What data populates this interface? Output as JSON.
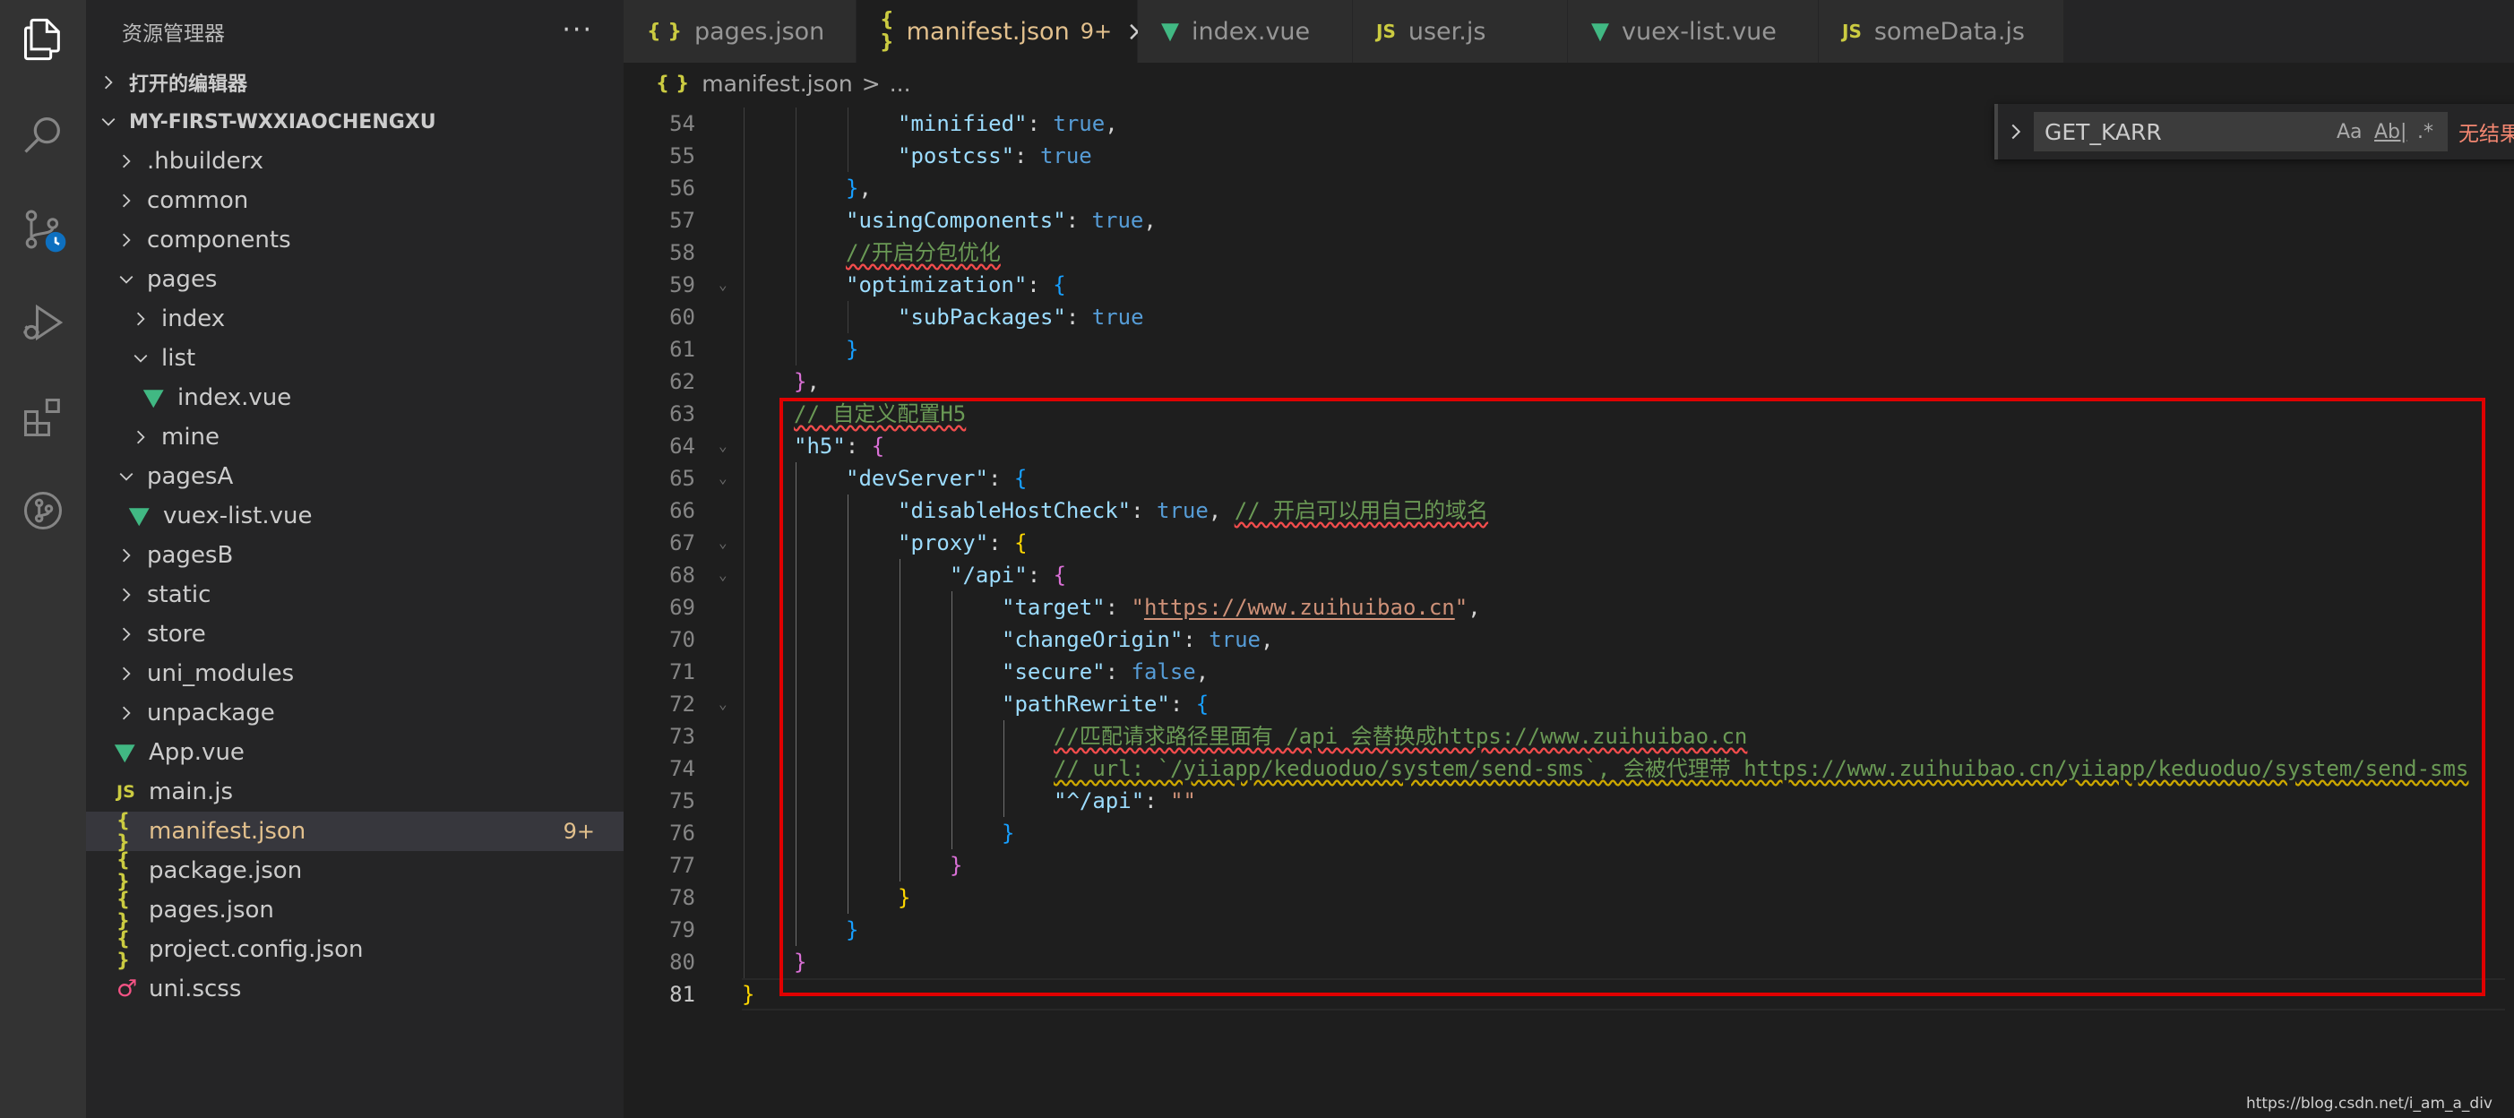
{
  "sidebar": {
    "title": "资源管理器",
    "more": "···",
    "open_editors": "打开的编辑器",
    "project": "MY-FIRST-WXXIAOCHENGXU",
    "items": [
      {
        "label": ".hbuilderx",
        "kind": "folder",
        "depth": 0,
        "expanded": false
      },
      {
        "label": "common",
        "kind": "folder",
        "depth": 0,
        "expanded": false
      },
      {
        "label": "components",
        "kind": "folder",
        "depth": 0,
        "expanded": false
      },
      {
        "label": "pages",
        "kind": "folder",
        "depth": 0,
        "expanded": true
      },
      {
        "label": "index",
        "kind": "folder",
        "depth": 1,
        "expanded": false
      },
      {
        "label": "list",
        "kind": "folder",
        "depth": 1,
        "expanded": true
      },
      {
        "label": "index.vue",
        "kind": "vue",
        "depth": 2
      },
      {
        "label": "mine",
        "kind": "folder",
        "depth": 1,
        "expanded": false
      },
      {
        "label": "pagesA",
        "kind": "folder",
        "depth": 0,
        "expanded": true
      },
      {
        "label": "vuex-list.vue",
        "kind": "vue",
        "depth": 1
      },
      {
        "label": "pagesB",
        "kind": "folder",
        "depth": 0,
        "expanded": false
      },
      {
        "label": "static",
        "kind": "folder",
        "depth": 0,
        "expanded": false
      },
      {
        "label": "store",
        "kind": "folder",
        "depth": 0,
        "expanded": false
      },
      {
        "label": "uni_modules",
        "kind": "folder",
        "depth": 0,
        "expanded": false
      },
      {
        "label": "unpackage",
        "kind": "folder",
        "depth": 0,
        "expanded": false
      },
      {
        "label": "App.vue",
        "kind": "vue",
        "depth": 0
      },
      {
        "label": "main.js",
        "kind": "js",
        "depth": 0
      },
      {
        "label": "manifest.json",
        "kind": "json",
        "depth": 0,
        "active": true,
        "badge": "9+"
      },
      {
        "label": "package.json",
        "kind": "json",
        "depth": 0
      },
      {
        "label": "pages.json",
        "kind": "json",
        "depth": 0
      },
      {
        "label": "project.config.json",
        "kind": "json",
        "depth": 0
      },
      {
        "label": "uni.scss",
        "kind": "scss",
        "depth": 0
      }
    ]
  },
  "tabs": [
    {
      "label": "pages.json",
      "kind": "json"
    },
    {
      "label": "manifest.json",
      "kind": "json",
      "active": true,
      "badge": "9+",
      "close": "×"
    },
    {
      "label": "index.vue",
      "kind": "vue"
    },
    {
      "label": "user.js",
      "kind": "js"
    },
    {
      "label": "vuex-list.vue",
      "kind": "vue"
    },
    {
      "label": "someData.js",
      "kind": "js"
    }
  ],
  "breadcrumb": {
    "file": "manifest.json",
    "sep": ">",
    "rest": "..."
  },
  "find": {
    "query": "GET_KARR",
    "opt_case": "Aa",
    "opt_word": "Ab|",
    "opt_regex": ".*",
    "result": "无结果"
  },
  "editor": {
    "lines": [
      {
        "n": "54",
        "indent": 3,
        "segments": [
          [
            "k",
            "\"minified\""
          ],
          [
            "p",
            ": "
          ],
          [
            "b",
            "true"
          ],
          [
            "p",
            ","
          ]
        ]
      },
      {
        "n": "55",
        "indent": 3,
        "segments": [
          [
            "k",
            "\"postcss\""
          ],
          [
            "p",
            ": "
          ],
          [
            "b",
            "true"
          ]
        ]
      },
      {
        "n": "56",
        "indent": 2,
        "segments": [
          [
            "br3",
            "}"
          ],
          [
            "p",
            ","
          ]
        ]
      },
      {
        "n": "57",
        "indent": 2,
        "segments": [
          [
            "k",
            "\"usingComponents\""
          ],
          [
            "p",
            ": "
          ],
          [
            "b",
            "true"
          ],
          [
            "p",
            ","
          ]
        ]
      },
      {
        "n": "58",
        "indent": 2,
        "segments": [
          [
            "c squig",
            "//开启分包优化"
          ]
        ]
      },
      {
        "n": "59",
        "indent": 2,
        "fold": true,
        "segments": [
          [
            "k",
            "\"optimization\""
          ],
          [
            "p",
            ": "
          ],
          [
            "br3",
            "{"
          ]
        ]
      },
      {
        "n": "60",
        "indent": 3,
        "segments": [
          [
            "k",
            "\"subPackages\""
          ],
          [
            "p",
            ": "
          ],
          [
            "b",
            "true"
          ]
        ]
      },
      {
        "n": "61",
        "indent": 2,
        "segments": [
          [
            "br3",
            "}"
          ]
        ]
      },
      {
        "n": "62",
        "indent": 1,
        "segments": [
          [
            "br2",
            "}"
          ],
          [
            "p",
            ","
          ]
        ]
      },
      {
        "n": "63",
        "indent": 1,
        "segments": [
          [
            "c squig",
            "// 自定义配置H5"
          ]
        ]
      },
      {
        "n": "64",
        "indent": 1,
        "fold": true,
        "segments": [
          [
            "k",
            "\"h5\""
          ],
          [
            "p",
            ": "
          ],
          [
            "br2",
            "{"
          ]
        ]
      },
      {
        "n": "65",
        "indent": 2,
        "fold": true,
        "segments": [
          [
            "k",
            "\"devServer\""
          ],
          [
            "p",
            ": "
          ],
          [
            "br3",
            "{"
          ]
        ]
      },
      {
        "n": "66",
        "indent": 3,
        "segments": [
          [
            "k",
            "\"disableHostCheck\""
          ],
          [
            "p",
            ": "
          ],
          [
            "b",
            "true"
          ],
          [
            "p",
            ", "
          ],
          [
            "c squig",
            "// 开启可以用自己的域名"
          ]
        ]
      },
      {
        "n": "67",
        "indent": 3,
        "fold": true,
        "segments": [
          [
            "k",
            "\"proxy\""
          ],
          [
            "p",
            ": "
          ],
          [
            "br1",
            "{"
          ]
        ]
      },
      {
        "n": "68",
        "indent": 4,
        "fold": true,
        "segments": [
          [
            "k",
            "\"/api\""
          ],
          [
            "p",
            ": "
          ],
          [
            "br2",
            "{"
          ]
        ]
      },
      {
        "n": "69",
        "indent": 5,
        "segments": [
          [
            "k",
            "\"target\""
          ],
          [
            "p",
            ": "
          ],
          [
            "s",
            "\""
          ],
          [
            "s u squig-y",
            "https://www.zuihuibao.cn"
          ],
          [
            "s",
            "\""
          ],
          [
            "p",
            ","
          ]
        ]
      },
      {
        "n": "70",
        "indent": 5,
        "segments": [
          [
            "k",
            "\"changeOrigin\""
          ],
          [
            "p",
            ": "
          ],
          [
            "b",
            "true"
          ],
          [
            "p",
            ","
          ]
        ]
      },
      {
        "n": "71",
        "indent": 5,
        "segments": [
          [
            "k",
            "\"secure\""
          ],
          [
            "p",
            ": "
          ],
          [
            "b",
            "false"
          ],
          [
            "p",
            ","
          ]
        ]
      },
      {
        "n": "72",
        "indent": 5,
        "fold": true,
        "segments": [
          [
            "k",
            "\"pathRewrite\""
          ],
          [
            "p",
            ": "
          ],
          [
            "br3",
            "{"
          ]
        ]
      },
      {
        "n": "73",
        "indent": 6,
        "segments": [
          [
            "c squig",
            "//匹配请求路径里面有 /api 会替换成https://www.zuihuibao.cn"
          ]
        ]
      },
      {
        "n": "74",
        "indent": 6,
        "segments": [
          [
            "c squig-y",
            "// url: `/yiiapp/keduoduo/system/send-sms`, 会被代理带 https://www.zuihuibao.cn/yiiapp/keduoduo/system/send-sms"
          ]
        ]
      },
      {
        "n": "75",
        "indent": 6,
        "segments": [
          [
            "k",
            "\"^/api\""
          ],
          [
            "p",
            ": "
          ],
          [
            "s",
            "\"\""
          ]
        ]
      },
      {
        "n": "76",
        "indent": 5,
        "segments": [
          [
            "br3",
            "}"
          ]
        ]
      },
      {
        "n": "77",
        "indent": 4,
        "segments": [
          [
            "br2",
            "}"
          ]
        ]
      },
      {
        "n": "78",
        "indent": 3,
        "segments": [
          [
            "br1",
            "}"
          ]
        ]
      },
      {
        "n": "79",
        "indent": 2,
        "segments": [
          [
            "br3",
            "}"
          ]
        ]
      },
      {
        "n": "80",
        "indent": 1,
        "segments": [
          [
            "br2",
            "}"
          ]
        ]
      },
      {
        "n": "81",
        "indent": 0,
        "current": true,
        "segments": [
          [
            "br1",
            "}"
          ]
        ]
      }
    ]
  },
  "watermark": "https://blog.csdn.net/i_am_a_div"
}
